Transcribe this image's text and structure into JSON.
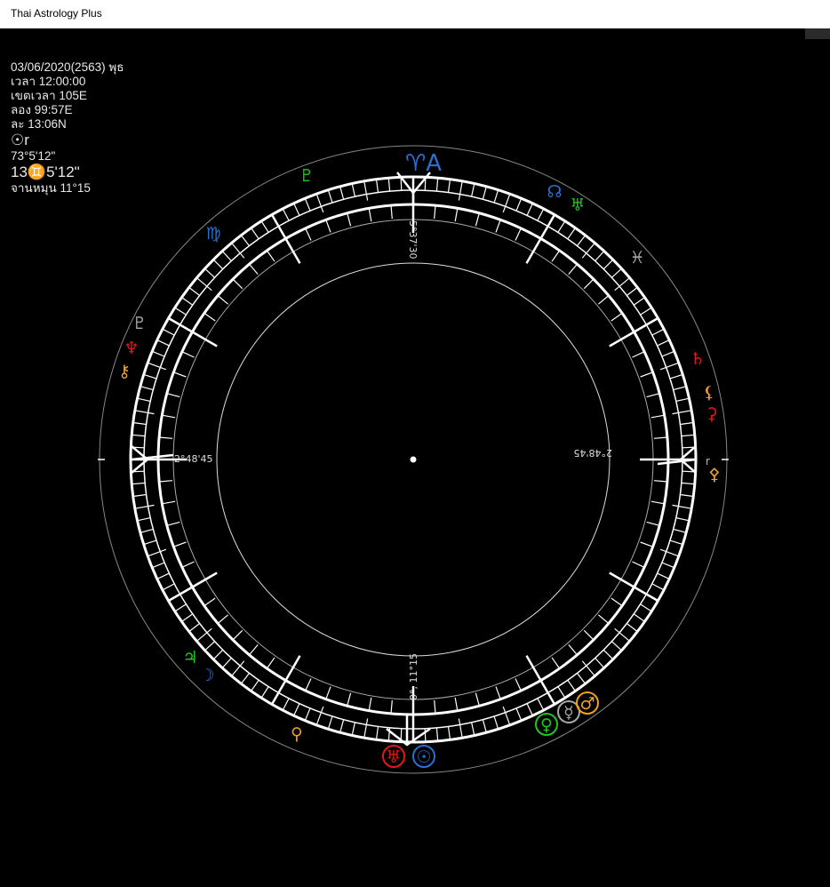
{
  "window": {
    "title": "Thai Astrology Plus"
  },
  "info": {
    "date": "03/06/2020(2563) พุธ",
    "time": "เวลา 12:00:00",
    "timezone": "เขตเวลา 105E",
    "longitude": "ลอง 99:57E",
    "latitude": "ละ 13:06N",
    "sun_label": "☉r",
    "sun_degree": "73°5'12\"",
    "sun_position": "13♊5'12\"",
    "moon_cycle": "จานหมุน 11°15"
  },
  "chart": {
    "top_glyph": "♈A",
    "labels": {
      "top": "5°37'30",
      "left": "2°48'45",
      "right": "2°48'45",
      "bottom": "0°, 11°15",
      "right_small": "r"
    },
    "colors": {
      "blue": "#2a6fd1",
      "green": "#22c51e",
      "red": "#e01818",
      "orange": "#f0a020",
      "gray": "#a8a8a8",
      "white": "#ffffff"
    },
    "planets": [
      {
        "name": "top-green-symbol",
        "glyph": "♇",
        "color": "green"
      },
      {
        "name": "node-blue",
        "glyph": "☊",
        "color": "blue"
      },
      {
        "name": "uranus-green",
        "glyph": "♅",
        "color": "green"
      },
      {
        "name": "pisces-gray",
        "glyph": "♓",
        "color": "gray"
      },
      {
        "name": "saturn-red",
        "glyph": "♄",
        "color": "red"
      },
      {
        "name": "orange-symbol-right",
        "glyph": "⚸",
        "color": "orange"
      },
      {
        "name": "red-symbol-right",
        "glyph": "⚳",
        "color": "red"
      },
      {
        "name": "orange-symbol-east",
        "glyph": "⚴",
        "color": "orange"
      },
      {
        "name": "virgo-blue",
        "glyph": "♍",
        "color": "blue"
      },
      {
        "name": "pluto-gray",
        "glyph": "♇",
        "color": "gray"
      },
      {
        "name": "neptune-red",
        "glyph": "♆",
        "color": "red"
      },
      {
        "name": "orange-symbol-left",
        "glyph": "⚷",
        "color": "orange"
      },
      {
        "name": "jupiter-green",
        "glyph": "♃",
        "color": "green"
      },
      {
        "name": "moon-blue",
        "glyph": "☽",
        "color": "blue"
      },
      {
        "name": "orange-symbol-bottom",
        "glyph": "⚲",
        "color": "orange"
      },
      {
        "name": "red-circle-symbol",
        "glyph": "♅",
        "color": "red"
      },
      {
        "name": "sun-blue",
        "glyph": "☉",
        "color": "blue"
      },
      {
        "name": "venus-green",
        "glyph": "♀",
        "color": "green"
      },
      {
        "name": "mercury-gray",
        "glyph": "☿",
        "color": "gray"
      },
      {
        "name": "mars-orange",
        "glyph": "♂",
        "color": "orange"
      }
    ]
  }
}
